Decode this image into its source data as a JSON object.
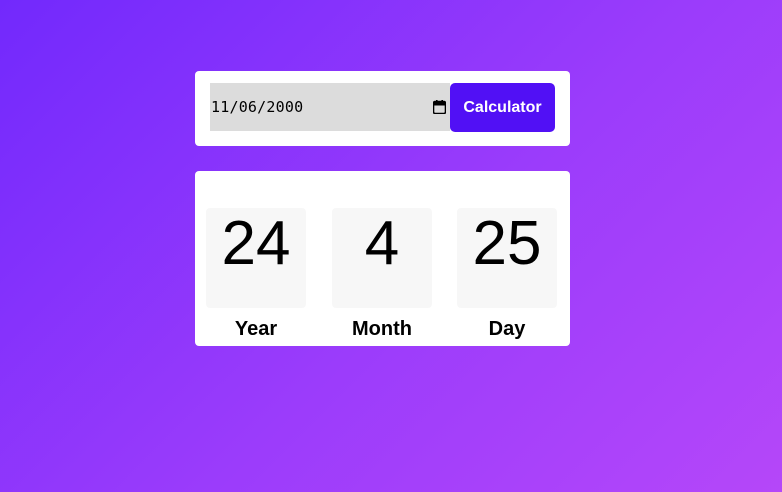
{
  "date_input": {
    "value": "11/06/2000",
    "icon": "calendar-icon"
  },
  "calculate_button": {
    "label": "Calculator",
    "color": "#5110f5"
  },
  "result": {
    "year": {
      "value": "24",
      "label": "Year"
    },
    "month": {
      "value": "4",
      "label": "Month"
    },
    "day": {
      "value": "25",
      "label": "Day"
    }
  },
  "colors": {
    "background_start": "#7229fc",
    "background_end": "#b547f9",
    "card": "#ffffff",
    "input_background": "#dcdcdc",
    "result_box": "#f7f7f7"
  }
}
